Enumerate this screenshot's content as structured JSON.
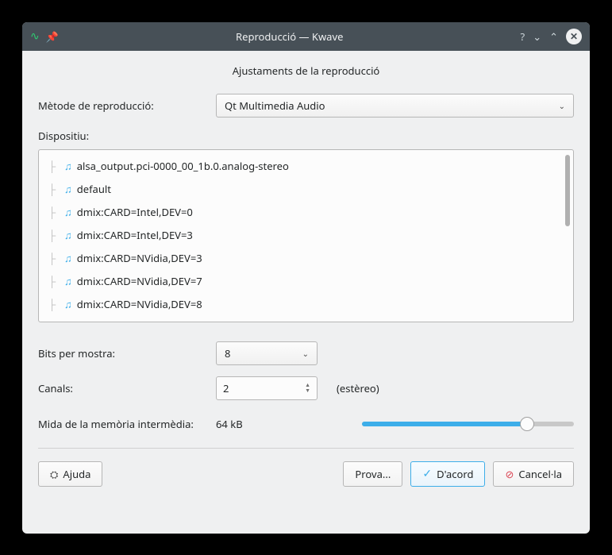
{
  "window": {
    "title": "Reproducció — Kwave"
  },
  "section_title": "Ajustaments de la reproducció",
  "method": {
    "label": "Mètode de reproducció:",
    "value": "Qt Multimedia Audio"
  },
  "devices": {
    "label": "Dispositiu:",
    "items": [
      "alsa_output.pci-0000_00_1b.0.analog-stereo",
      "default",
      "dmix:CARD=Intel,DEV=0",
      "dmix:CARD=Intel,DEV=3",
      "dmix:CARD=NVidia,DEV=3",
      "dmix:CARD=NVidia,DEV=7",
      "dmix:CARD=NVidia,DEV=8"
    ]
  },
  "bits": {
    "label": "Bits per mostra:",
    "value": "8"
  },
  "channels": {
    "label": "Canals:",
    "value": "2",
    "hint": "(estèreo)"
  },
  "buffer": {
    "label": "Mida de la memòria intermèdia:",
    "value": "64 kB"
  },
  "buttons": {
    "help": "Ajuda",
    "test": "Prova...",
    "ok": "D'acord",
    "cancel": "Cancel·la"
  }
}
